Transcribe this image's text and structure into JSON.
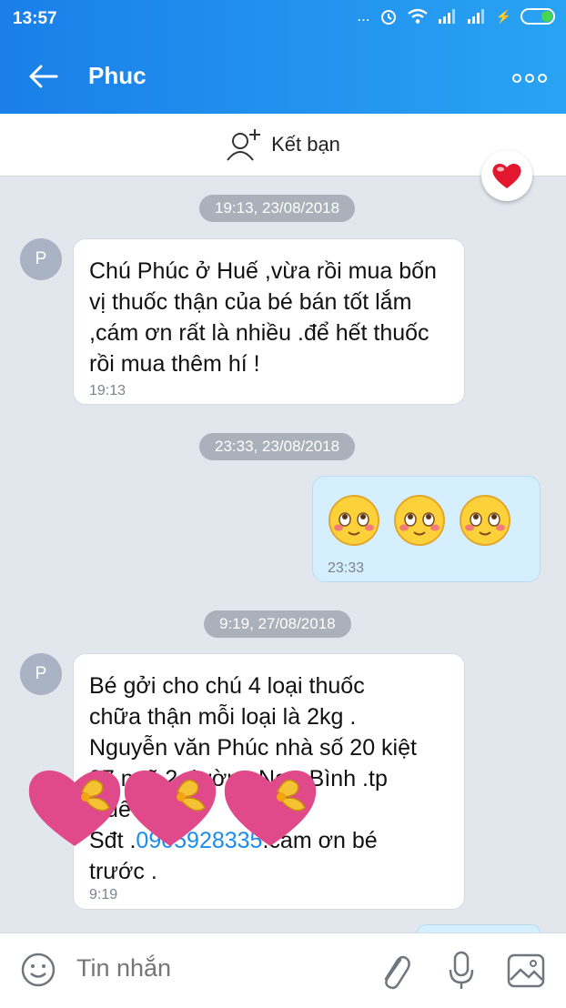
{
  "status_bar": {
    "time": "13:57",
    "dots": "...",
    "bolt": "⚡"
  },
  "header": {
    "title": "Phuc"
  },
  "friend_bar": {
    "label": "Kết bạn"
  },
  "conversation": {
    "stamps": [
      "19:13, 23/08/2018",
      "23:33, 23/08/2018",
      "9:19, 27/08/2018"
    ],
    "avatar_initial": "P",
    "messages": [
      {
        "direction": "incoming",
        "text": "Chú Phúc ở Huế ,vừa rồi mua bốn vị thuốc thận của bé bán tốt lắm ,cám ơn rất là nhiều .để hết thuốc rồi mua thêm hí !",
        "time": "19:13"
      },
      {
        "direction": "outgoing",
        "emoji_count": 3,
        "time": "23:33"
      },
      {
        "direction": "incoming",
        "line1": "Bé gởi cho chú 4 loại thuốc",
        "line2": "chữa thận mỗi loại là 2kg .",
        "line3": "Nguyễn văn Phúc nhà số 20 kiệt",
        "line4": "27 ngõ 2 đường Ngự Bình .tp",
        "line5": "Huế",
        "phone_prefix": "Sđt .",
        "phone": "0905928335",
        "phone_suffix": ".cám ơn bé",
        "line7": "trước .",
        "time": "9:19"
      }
    ]
  },
  "composer": {
    "placeholder": "Tin nhắn"
  },
  "colors": {
    "header": "#1a7fe9",
    "bubble_out": "#d6efff",
    "bubble_in": "#ffffff",
    "background": "#e2e7ee",
    "heart": "#e3172d"
  }
}
